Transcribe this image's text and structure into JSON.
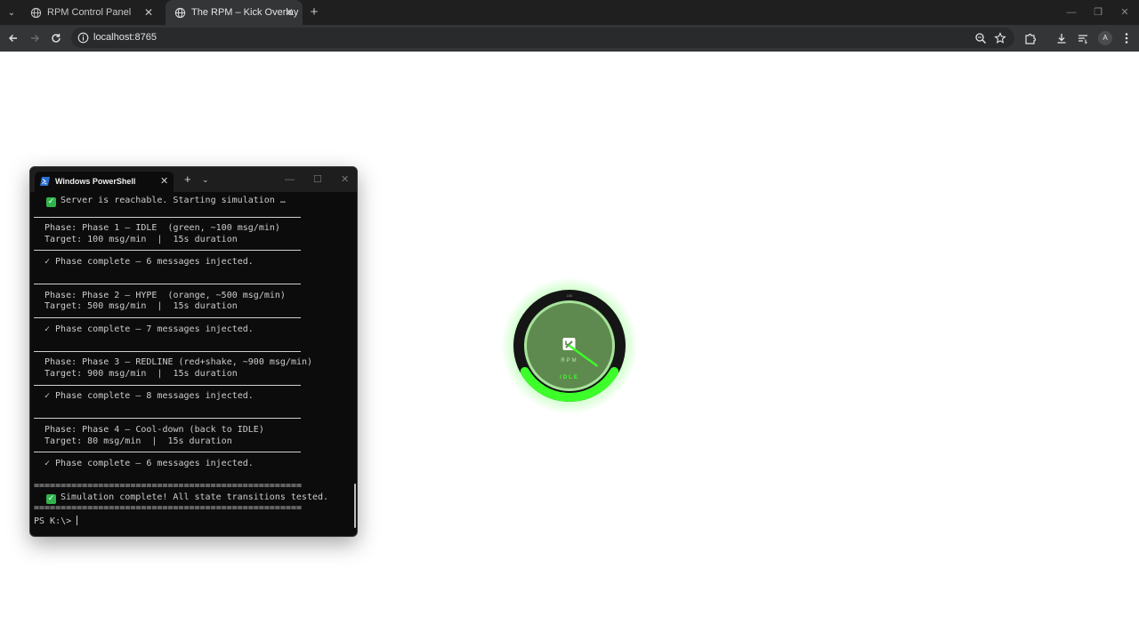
{
  "browser": {
    "tabs": [
      {
        "title": "RPM Control Panel",
        "active": false
      },
      {
        "title": "The RPM – Kick Overlay",
        "active": true
      }
    ],
    "url": "localhost:8765",
    "profile_initial": "A",
    "theme": {
      "chrome_bg": "#1f1f1f",
      "toolbar_bg": "#333537",
      "omnibox_bg": "#282a2c"
    }
  },
  "terminal": {
    "tab_title": "Windows PowerShell",
    "lines": [
      {
        "type": "check",
        "text": "Server is reachable. Starting simulation …"
      },
      {
        "type": "sep"
      },
      {
        "type": "text",
        "text": "Phase: Phase 1 – IDLE  (green, ~100 msg/min)"
      },
      {
        "type": "text",
        "text": "Target: 100 msg/min  |  15s duration"
      },
      {
        "type": "sep"
      },
      {
        "type": "text",
        "text": "✓ Phase complete – 6 messages injected."
      },
      {
        "type": "sep"
      },
      {
        "type": "text",
        "text": "Phase: Phase 2 – HYPE  (orange, ~500 msg/min)"
      },
      {
        "type": "text",
        "text": "Target: 500 msg/min  |  15s duration"
      },
      {
        "type": "sep"
      },
      {
        "type": "text",
        "text": "✓ Phase complete – 7 messages injected."
      },
      {
        "type": "sep"
      },
      {
        "type": "text",
        "text": "Phase: Phase 3 – REDLINE (red+shake, ~900 msg/min)"
      },
      {
        "type": "text",
        "text": "Target: 900 msg/min  |  15s duration"
      },
      {
        "type": "sep"
      },
      {
        "type": "text",
        "text": "✓ Phase complete – 8 messages injected."
      },
      {
        "type": "sep"
      },
      {
        "type": "text",
        "text": "Phase: Phase 4 – Cool-down (back to IDLE)"
      },
      {
        "type": "text",
        "text": "Target: 80 msg/min  |  15s duration"
      },
      {
        "type": "sep"
      },
      {
        "type": "text",
        "text": "✓ Phase complete – 6 messages injected."
      },
      {
        "type": "text",
        "text": "=================================================="
      },
      {
        "type": "check",
        "text": "Simulation complete! All state transitions tested."
      },
      {
        "type": "text",
        "text": "=================================================="
      }
    ],
    "prompt": "PS K:\\> "
  },
  "gauge": {
    "label": "RPM",
    "state": "IDLE",
    "top_tick": "180",
    "level": 0.35,
    "colors": {
      "accent": "#3cff2a",
      "face": "#5f8a4f",
      "rim": "#1a1a1a",
      "ring": "#a6e39a"
    }
  }
}
